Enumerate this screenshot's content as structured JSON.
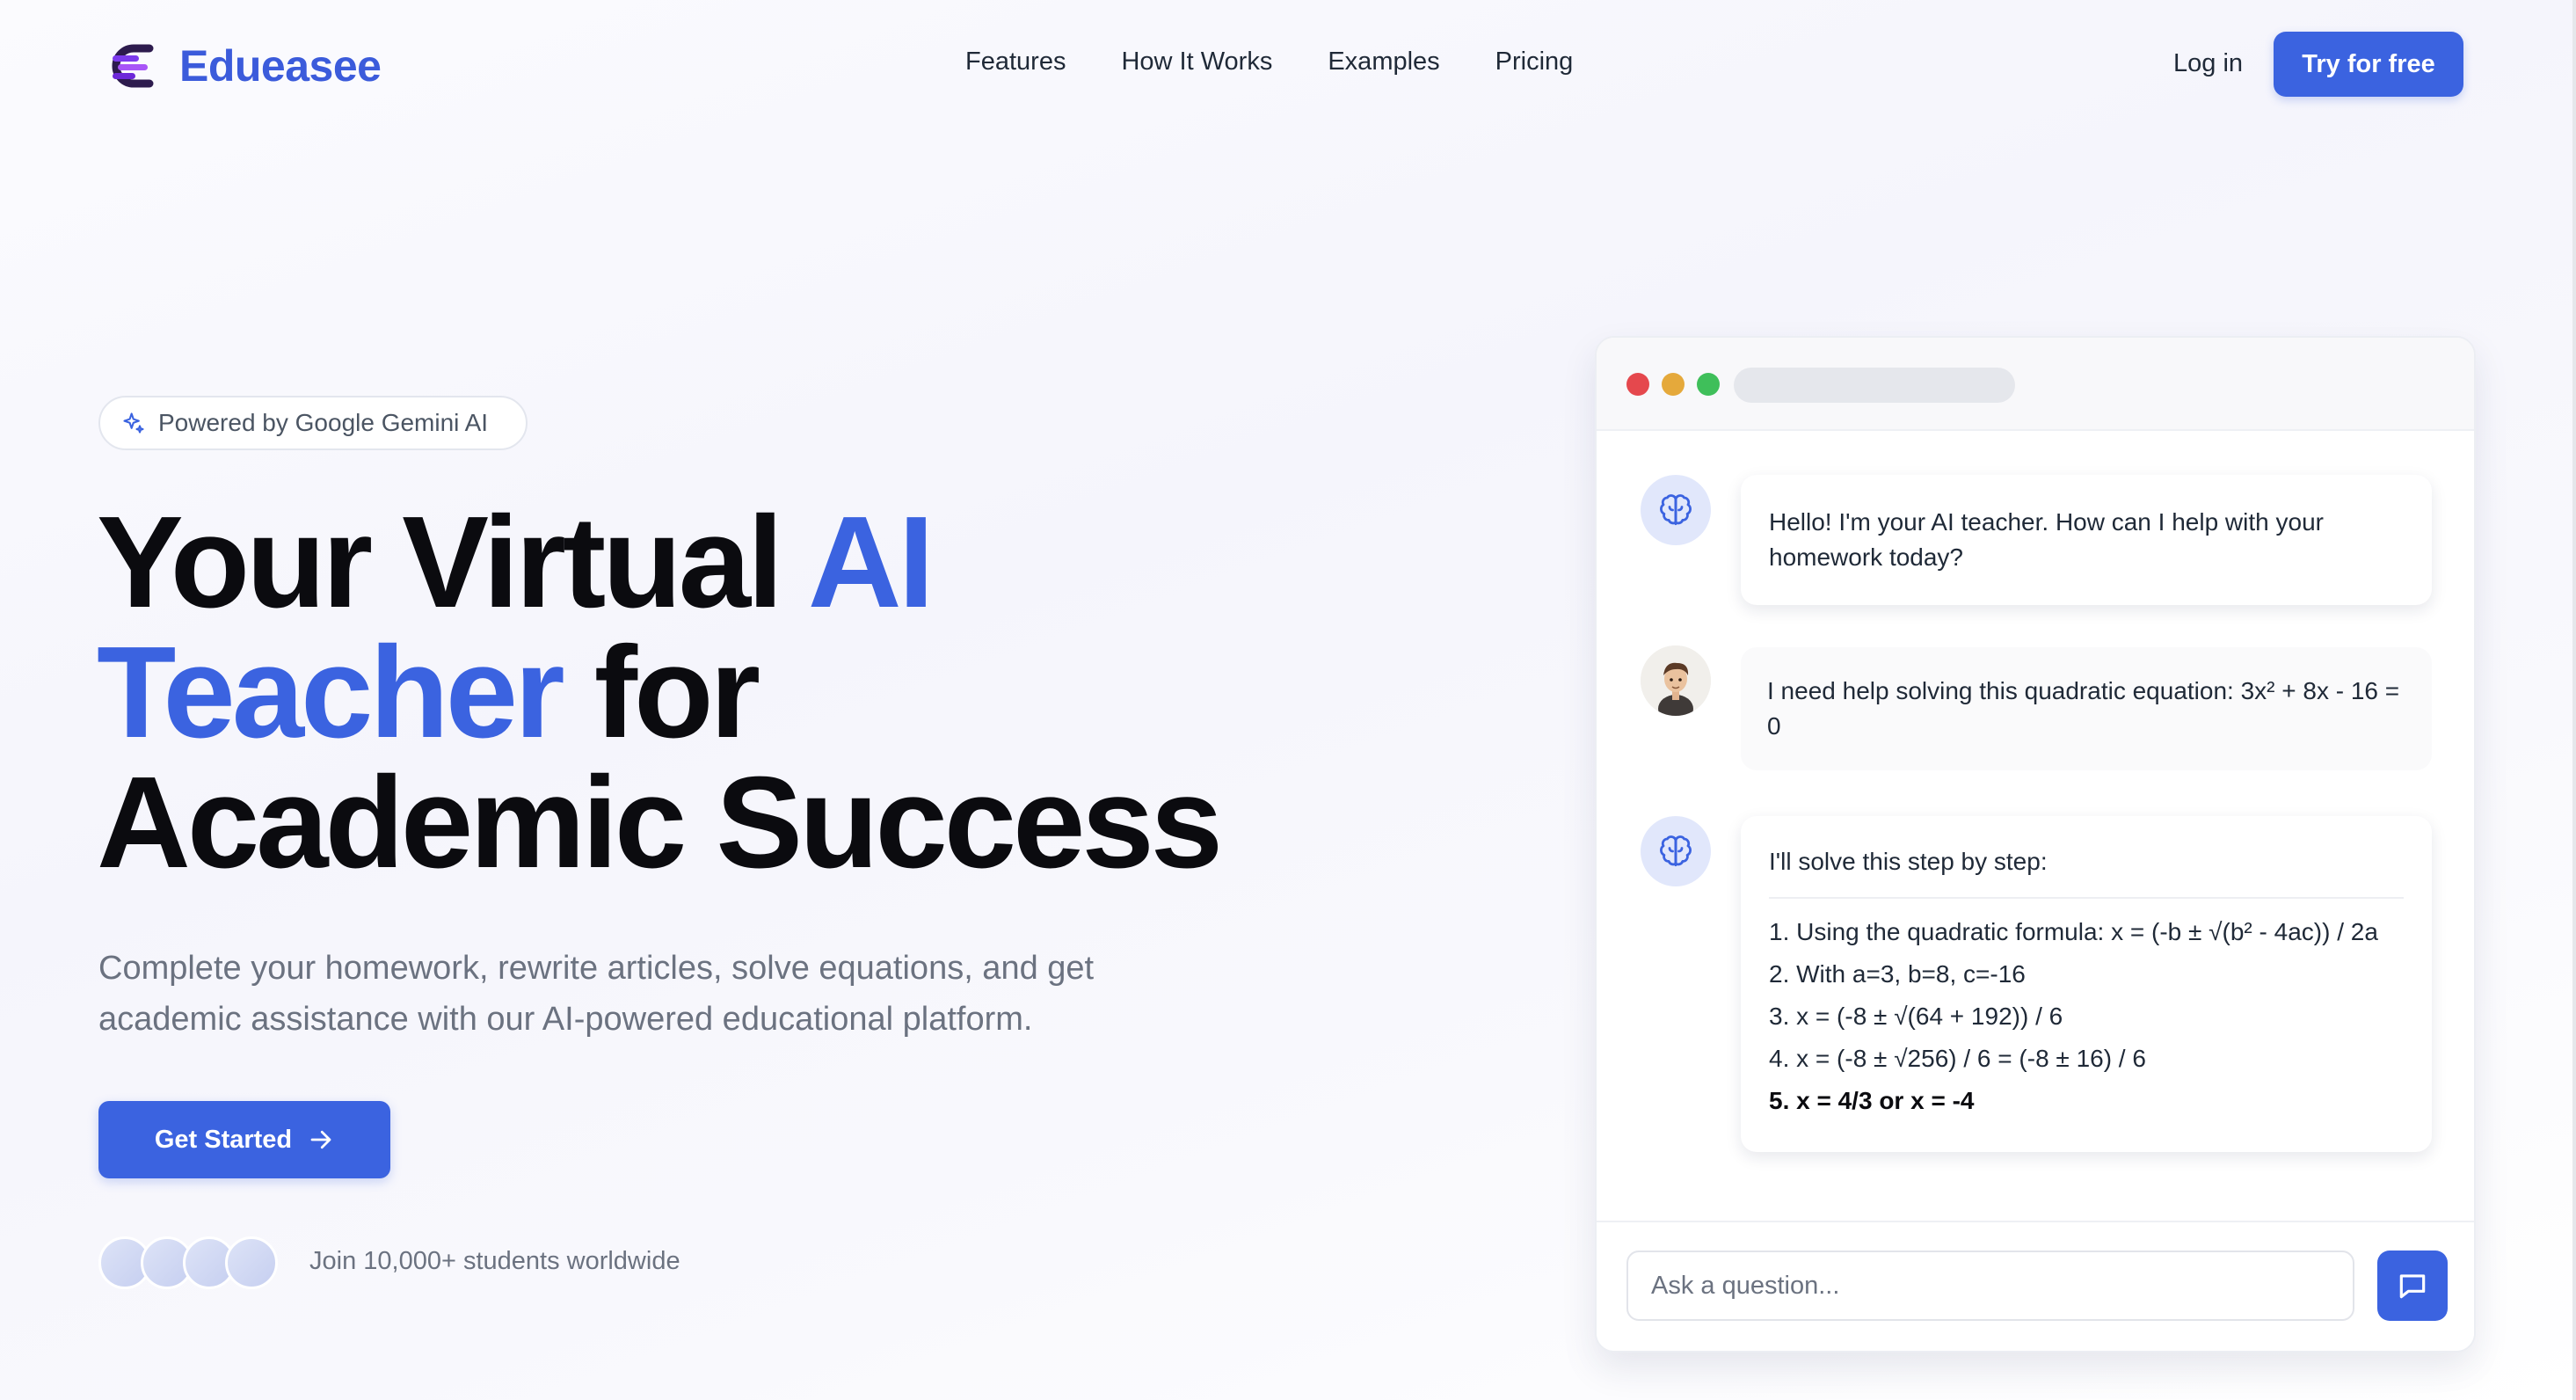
{
  "brand": {
    "name": "Edueasee",
    "logo_icon": "stacked-e-logo-icon"
  },
  "nav": {
    "items": [
      {
        "label": "Features"
      },
      {
        "label": "How It Works"
      },
      {
        "label": "Examples"
      },
      {
        "label": "Pricing"
      }
    ],
    "login_label": "Log in",
    "cta_label": "Try for free"
  },
  "hero": {
    "badge": "Powered by Google Gemini AI",
    "badge_icon": "sparkle-icon",
    "headline_part1": "Your Virtual ",
    "headline_highlight1": "AI",
    "headline_highlight2": "Teacher",
    "headline_part2": " for",
    "headline_part3": "Academic Success",
    "subtext": "Complete your homework, rewrite articles, solve equations, and get academic assistance with our AI-powered educational platform.",
    "cta_label": "Get Started",
    "cta_icon": "arrow-right-icon",
    "social_proof": "Join 10,000+ students worldwide"
  },
  "chat": {
    "messages": [
      {
        "role": "ai",
        "icon": "brain-icon",
        "text": "Hello! I'm your AI teacher. How can I help with your homework today?"
      },
      {
        "role": "user",
        "icon": "user-avatar",
        "text": "I need help solving this quadratic equation: 3x² + 8x - 16 = 0"
      },
      {
        "role": "ai",
        "icon": "brain-icon",
        "intro": "I'll solve this step by step:",
        "steps": [
          "1. Using the quadratic formula: x = (-b ± √(b² - 4ac)) / 2a",
          "2. With a=3, b=8, c=-16",
          "3. x = (-8 ± √(64 + 192)) / 6",
          "4. x = (-8 ± √256) / 6 = (-8 ± 16) / 6",
          "5. x = 4/3 or x = -4"
        ]
      }
    ],
    "input_placeholder": "Ask a question...",
    "send_icon": "message-square-icon"
  },
  "colors": {
    "accent": "#3b63e0",
    "headline": "#0b0b0f",
    "muted_text": "#6b7280"
  }
}
